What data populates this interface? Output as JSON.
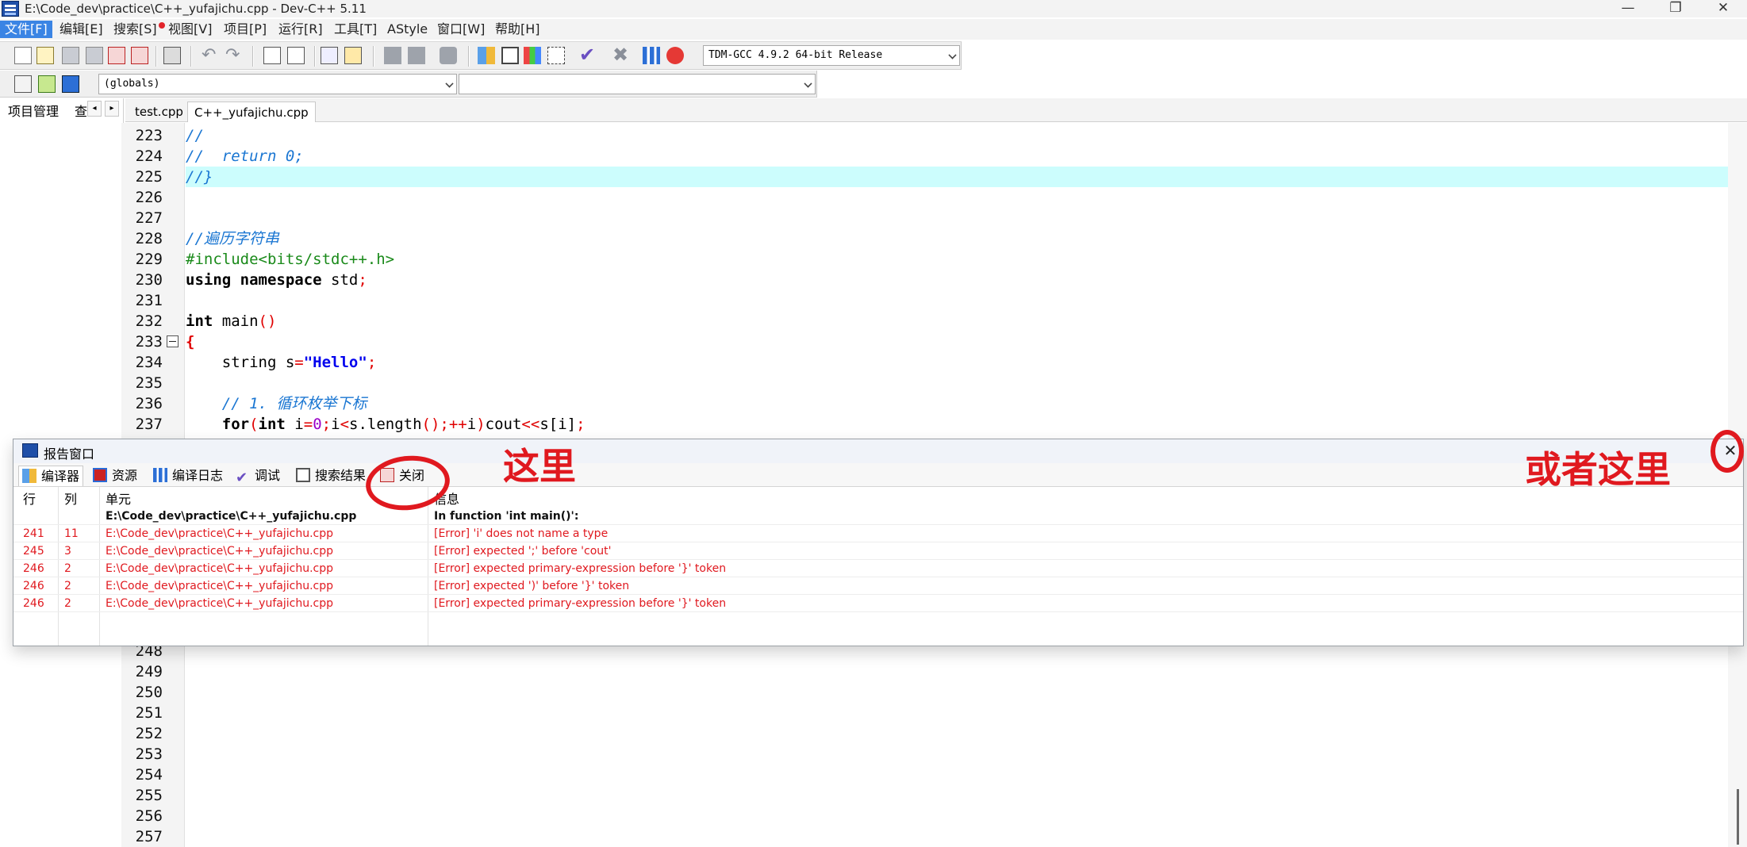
{
  "window": {
    "title": "E:\\Code_dev\\practice\\C++_yufajichu.cpp - Dev-C++ 5.11",
    "minimize": "—",
    "restore": "❐",
    "close": "✕"
  },
  "menu": [
    "文件[F]",
    "编辑[E]",
    "搜索[S]",
    "视图[V]",
    "项目[P]",
    "运行[R]",
    "工具[T]",
    "AStyle",
    "窗口[W]",
    "帮助[H]"
  ],
  "toolbar": {
    "compiler_select": "TDM-GCC 4.9.2 64-bit Release",
    "scope_select": "(globals)",
    "symbol_select": ""
  },
  "left_panel": {
    "tab_project": "项目管理",
    "tab_other": "查",
    "arrow_left": "◂",
    "arrow_right": "▸"
  },
  "editor": {
    "tabs": [
      "test.cpp",
      "C++_yufajichu.cpp"
    ],
    "active_tab_index": 1,
    "highlighted_line": 225,
    "line_numbers": [
      "223",
      "224",
      "225",
      "226",
      "227",
      "228",
      "229",
      "230",
      "231",
      "232",
      "233",
      "234",
      "235",
      "236",
      "237",
      "248",
      "249",
      "250",
      "251",
      "252",
      "253",
      "254",
      "255",
      "256",
      "257"
    ],
    "code": {
      "l223": "//",
      "l224": "//  return 0;",
      "l225": "//}",
      "l228": "//遍历字符串",
      "l229": "#include<bits/stdc++.h>",
      "l230_kw": "using namespace",
      "l230_rest": " std",
      "l230_semi": ";",
      "l232_kw": "int",
      "l232_fn": " main",
      "l232_paren": "()",
      "l233_brace": "{",
      "l234_indent": "    string s",
      "l234_eq": "=",
      "l234_str": "\"Hello\"",
      "l234_semi": ";",
      "l236": "    // 1. 循环枚举下标",
      "l237_for": "    for",
      "l237_p1": "(",
      "l237_int": "int",
      "l237_i": " i",
      "l237_eq": "=",
      "l237_zero": "0",
      "l237_semi1": ";",
      "l237_i2": "i",
      "l237_lt": "<",
      "l237_len": "s.length",
      "l237_p2": "();",
      "l237_pp": "++",
      "l237_i3": "i",
      "l237_p3": ")",
      "l237_cout": "cout",
      "l237_shl": "<<",
      "l237_si": "s[i]",
      "l237_semi2": ";"
    }
  },
  "report": {
    "title": "报告窗口",
    "close_glyph": "✕",
    "tabs": [
      "编译器",
      "资源",
      "编译日志",
      "调试",
      "搜索结果",
      "关闭"
    ],
    "columns": [
      "行",
      "列",
      "单元",
      "信息"
    ],
    "file_header": {
      "unit": "E:\\Code_dev\\practice\\C++_yufajichu.cpp",
      "info": "In function 'int main()':"
    },
    "rows": [
      {
        "line": "241",
        "col": "11",
        "unit": "E:\\Code_dev\\practice\\C++_yufajichu.cpp",
        "info": "[Error] 'i' does not name a type"
      },
      {
        "line": "245",
        "col": "3",
        "unit": "E:\\Code_dev\\practice\\C++_yufajichu.cpp",
        "info": "[Error] expected ';' before 'cout'"
      },
      {
        "line": "246",
        "col": "2",
        "unit": "E:\\Code_dev\\practice\\C++_yufajichu.cpp",
        "info": "[Error] expected primary-expression before '}' token"
      },
      {
        "line": "246",
        "col": "2",
        "unit": "E:\\Code_dev\\practice\\C++_yufajichu.cpp",
        "info": "[Error] expected ')' before '}' token"
      },
      {
        "line": "246",
        "col": "2",
        "unit": "E:\\Code_dev\\practice\\C++_yufajichu.cpp",
        "info": "[Error] expected primary-expression before '}' token"
      }
    ]
  },
  "annotations": {
    "here": "这里",
    "or_here": "或者这里",
    "color": "#e0191f"
  },
  "colors": {
    "menu_active": "#3a84e4",
    "current_line": "#ccfdfd",
    "comment": "#1a76d2",
    "error_text": "#e0191f"
  }
}
